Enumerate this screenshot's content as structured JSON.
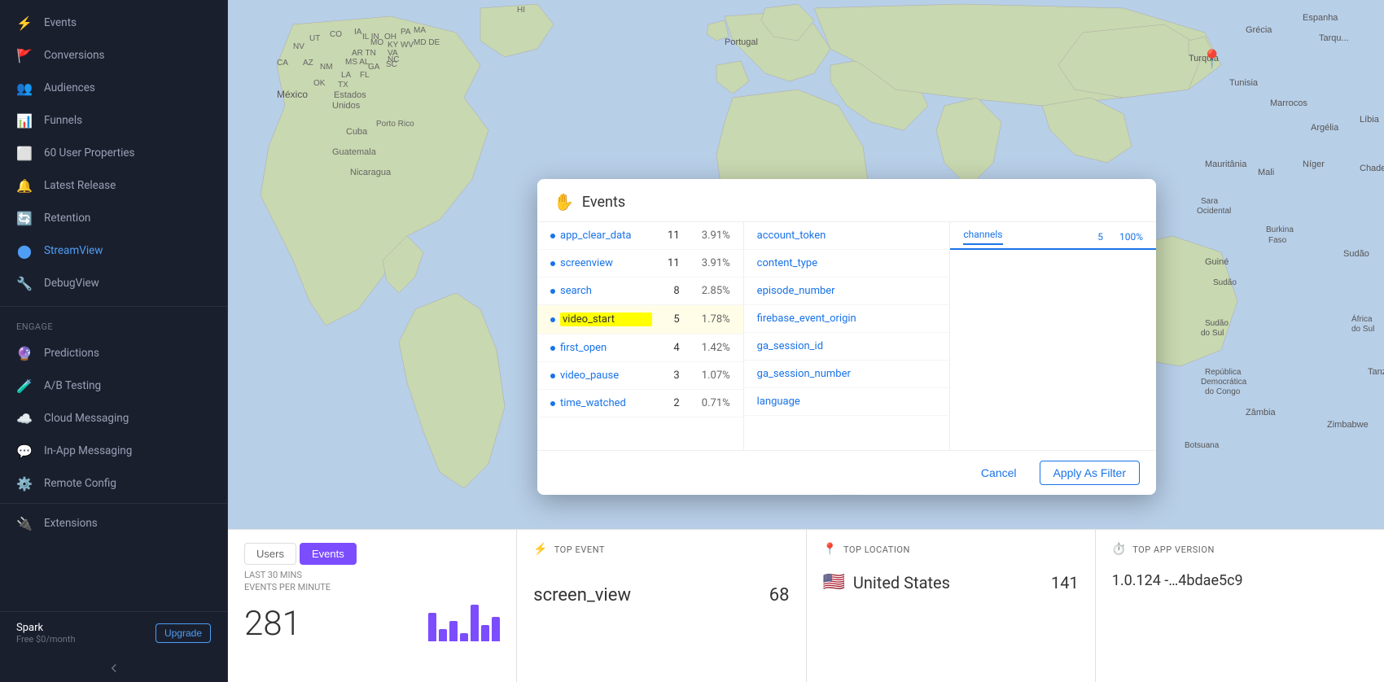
{
  "sidebar": {
    "items_top": [
      {
        "label": "Events",
        "icon": "⚡"
      },
      {
        "label": "Conversions",
        "icon": "🚩"
      },
      {
        "label": "Audiences",
        "icon": "👥"
      },
      {
        "label": "Funnels",
        "icon": "📊"
      },
      {
        "label": "User Properties",
        "icon": "🔲",
        "badge": "60"
      },
      {
        "label": "Latest Release",
        "icon": "🔔"
      },
      {
        "label": "Retention",
        "icon": "🔄"
      },
      {
        "label": "StreamView",
        "icon": "🔵",
        "active": true
      },
      {
        "label": "DebugView",
        "icon": "🔧"
      }
    ],
    "section_engage": "Engage",
    "items_engage": [
      {
        "label": "Predictions",
        "icon": "🔮"
      },
      {
        "label": "A/B Testing",
        "icon": "🧪"
      },
      {
        "label": "Cloud Messaging",
        "icon": "☁️"
      },
      {
        "label": "In-App Messaging",
        "icon": "💬"
      },
      {
        "label": "Remote Config",
        "icon": "⚙️"
      }
    ],
    "items_bottom": [
      {
        "label": "Extensions",
        "icon": "🔌"
      }
    ],
    "spark_title": "Spark",
    "spark_sub": "Free $0/month",
    "upgrade_label": "Upgrade"
  },
  "bottom_bar": {
    "users_tab": "Users",
    "events_tab": "Events",
    "last_label": "LAST 30 MINS",
    "epm_label": "EVENTS PER MINUTE",
    "epm_value": "281",
    "top_event_label": "TOP EVENT",
    "top_event_name": "screen_view",
    "top_event_count": "68",
    "top_location_label": "TOP LOCATION",
    "top_location_country": "United States",
    "top_location_count": "141",
    "top_app_label": "TOP APP VERSION",
    "top_app_version": "1.0.124 -…4bdae5c9"
  },
  "modal": {
    "title": "Events",
    "icon": "✋",
    "events": [
      {
        "name": "app_clear_data",
        "count": "11",
        "pct": "3.91%",
        "highlighted": false
      },
      {
        "name": "screenview",
        "count": "11",
        "pct": "3.91%",
        "highlighted": false
      },
      {
        "name": "search",
        "count": "8",
        "pct": "2.85%",
        "highlighted": false
      },
      {
        "name": "video_start",
        "count": "5",
        "pct": "1.78%",
        "highlighted": true
      },
      {
        "name": "first_open",
        "count": "4",
        "pct": "1.42%",
        "highlighted": false
      },
      {
        "name": "video_pause",
        "count": "3",
        "pct": "1.07%",
        "highlighted": false
      },
      {
        "name": "time_watched",
        "count": "2",
        "pct": "0.71%",
        "highlighted": false
      }
    ],
    "params": [
      {
        "name": "account_token"
      },
      {
        "name": "content_type"
      },
      {
        "name": "episode_number"
      },
      {
        "name": "firebase_event_origin"
      },
      {
        "name": "ga_session_id"
      },
      {
        "name": "ga_session_number"
      },
      {
        "name": "language"
      }
    ],
    "channels_label": "channels",
    "channels_count": "5",
    "channels_pct": "100%",
    "cancel_label": "Cancel",
    "apply_label": "Apply As Filter"
  }
}
